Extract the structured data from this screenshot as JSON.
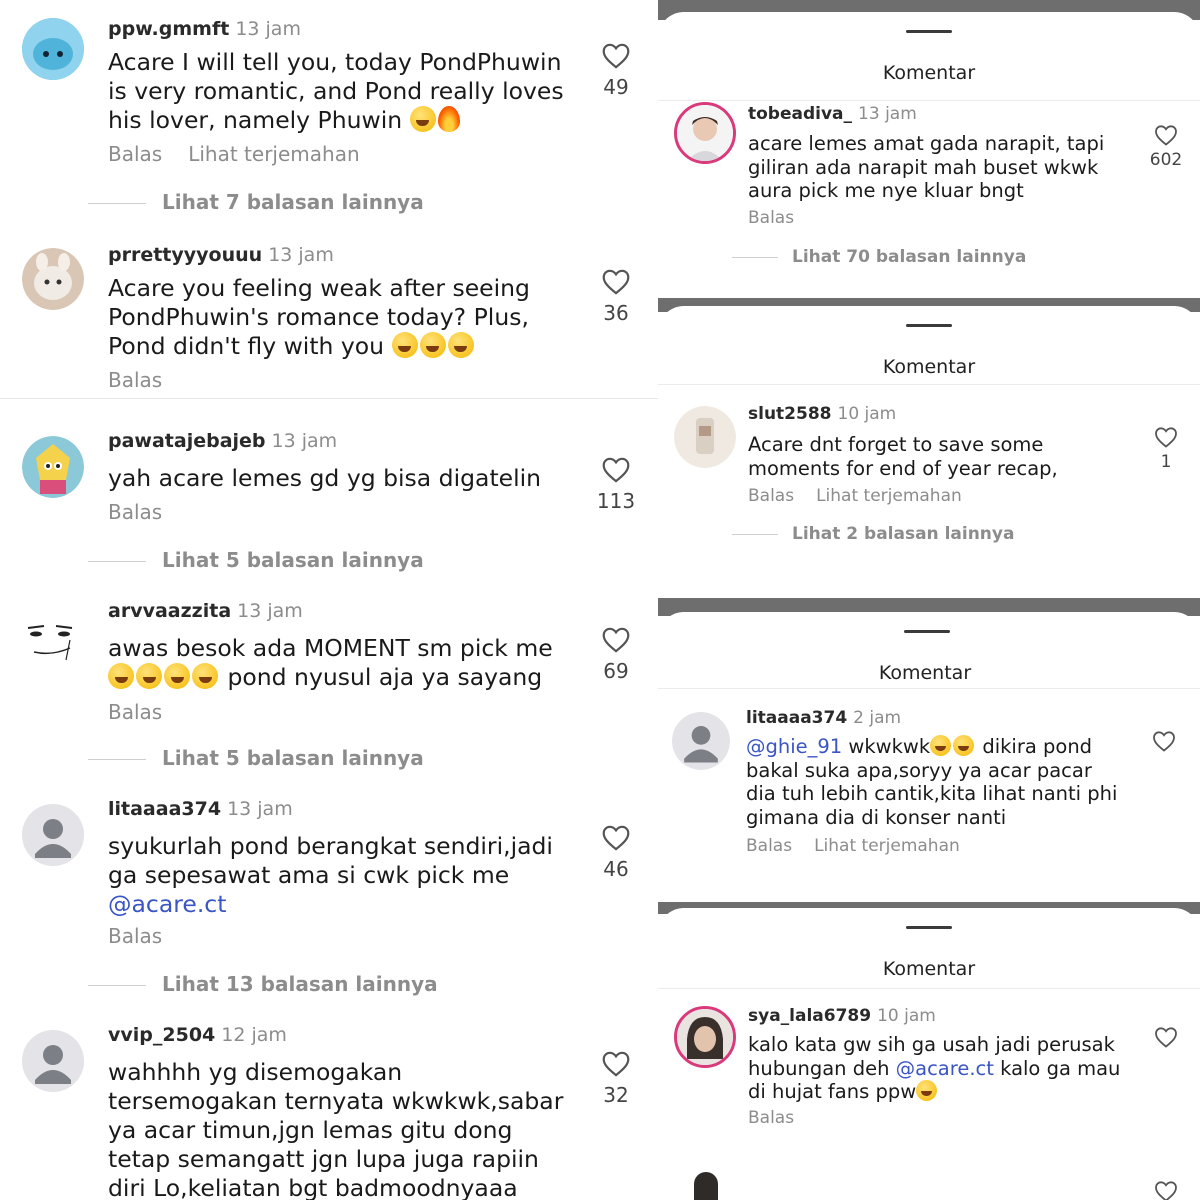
{
  "left_comments": [
    {
      "user": "ppw.gmmft",
      "time": "13 jam",
      "text_parts": [
        {
          "t": "Acare I will tell you, today PondPhuwin is very romantic, and Pond really loves his lover, namely Phuwin "
        }
      ],
      "emojis": [
        "grinning-tears",
        "fire"
      ],
      "actions": [
        "Balas",
        "Lihat terjemahan"
      ],
      "likes": "49",
      "more_replies": "Lihat 7 balasan lainnya",
      "avatar": "blue-plush"
    },
    {
      "user": "prrettyyyouuu",
      "time": "13 jam",
      "text_parts": [
        {
          "t": "Acare you feeling weak after seeing PondPhuwin's romance today? Plus, Pond didn't fly with you "
        }
      ],
      "emojis": [
        "grinning-tears",
        "grinning-tears",
        "grinning-tears"
      ],
      "actions": [
        "Balas"
      ],
      "likes": "36",
      "avatar": "cat"
    },
    {
      "user": "pawatajebajeb",
      "time": "13 jam",
      "text_parts": [
        {
          "t": "yah acare lemes gd yg bisa digatelin"
        }
      ],
      "actions": [
        "Balas"
      ],
      "likes": "113",
      "more_replies": "Lihat 5 balasan lainnya",
      "avatar": "cartoon"
    },
    {
      "user": "arvvaazzita",
      "time": "13 jam",
      "text_line1": "awas besok ada MOMENT sm pick me",
      "text_line2": " pond nyusul aja ya sayang",
      "emojis": [
        "grinning-tears",
        "grinning-tears",
        "grinning-tears",
        "grinning-tears"
      ],
      "actions": [
        "Balas"
      ],
      "likes": "69",
      "more_replies": "Lihat 5 balasan lainnya",
      "avatar": "meme-face"
    },
    {
      "user": "litaaaa374",
      "time": "13 jam",
      "text": "syukurlah pond berangkat sendiri,jadi ga sepesawat ama si cwk pick me",
      "mention": "@acare.ct",
      "actions": [
        "Balas"
      ],
      "likes": "46",
      "more_replies": "Lihat 13 balasan lainnya",
      "avatar": "default"
    },
    {
      "user": "vvip_2504",
      "time": "12 jam",
      "text": "wahhhh yg disemogakan tersemogakan ternyata wkwkwk,sabar ya acar timun,jgn lemas gitu dong tetap semangatt jgn lupa juga rapiin diri Lo,keliatan bgt badmoodnyaaa",
      "likes": "32",
      "avatar": "default"
    }
  ],
  "panels": [
    {
      "title": "Komentar",
      "user": "tobeadiva_",
      "time": "13 jam",
      "text": "acare lemes amat gada narapit, tapi giliran ada narapit mah buset wkwk aura pick me nye kluar bngt",
      "actions": [
        "Balas"
      ],
      "likes": "602",
      "more_replies": "Lihat 70 balasan lainnya",
      "avatar": "photo-story"
    },
    {
      "title": "Komentar",
      "user": "slut2588",
      "time": "10 jam",
      "text": "Acare dnt forget to save some moments for end of year recap,",
      "actions": [
        "Balas",
        "Lihat terjemahan"
      ],
      "likes": "1",
      "more_replies": "Lihat 2 balasan lainnya",
      "avatar": "photo"
    },
    {
      "title": "Komentar",
      "user": "litaaaa374",
      "time": "2 jam",
      "mention": "@ghie_91",
      "text_a": " wkwkwk",
      "text_b": " dikira pond bakal suka apa,soryy ya acar pacar dia tuh lebih cantik,kita lihat nanti phi gimana dia di konser nanti",
      "actions": [
        "Balas",
        "Lihat terjemahan"
      ],
      "likes": "",
      "avatar": "default"
    },
    {
      "title": "Komentar",
      "user": "sya_lala6789",
      "time": "10 jam",
      "text_a": "kalo kata gw sih ga usah jadi perusak hubungan deh ",
      "mention": "@acare.ct",
      "text_b": " kalo ga mau di hujat fans ppw",
      "actions": [
        "Balas"
      ],
      "likes": "",
      "avatar": "photo-story"
    }
  ],
  "colors": {
    "mention": "#3a55c4",
    "muted": "#8c8c8c",
    "strip": "#6e6e6e"
  }
}
